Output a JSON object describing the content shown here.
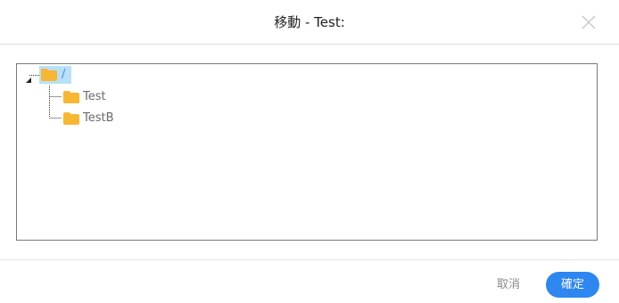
{
  "dialog": {
    "title": "移動 - Test:"
  },
  "tree": {
    "root": {
      "label": "/",
      "icon": "folder-icon",
      "selected": true,
      "expanded": true
    },
    "children": [
      {
        "label": "Test",
        "icon": "folder-icon"
      },
      {
        "label": "TestB",
        "icon": "folder-icon"
      }
    ]
  },
  "footer": {
    "cancel_label": "取消",
    "ok_label": "確定"
  },
  "colors": {
    "accent": "#2e86f0",
    "folder": "#f7b733",
    "selection": "#b8e0f8"
  }
}
